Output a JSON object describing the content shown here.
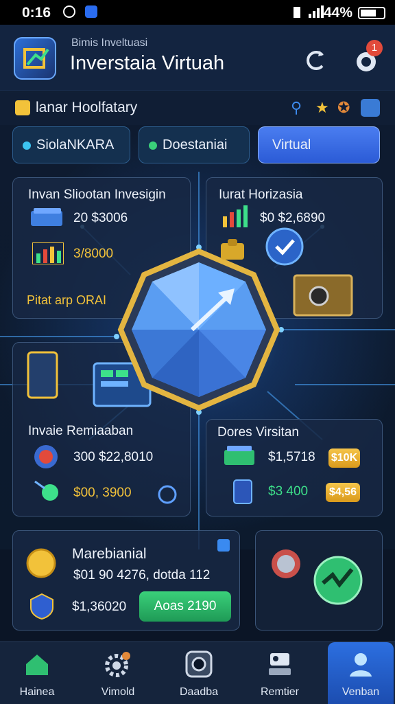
{
  "status_bar": {
    "time": "0:16",
    "battery": "44%"
  },
  "header": {
    "subtitle": "Bimis Inveltuasi",
    "title": "Inverstaia Virtuah",
    "notification_count": "1"
  },
  "section": {
    "title": "lanar Hoolfatary"
  },
  "tabs": [
    {
      "label": "SiolaNKARA",
      "dot_color": "#3cc3f0"
    },
    {
      "label": "Doestaniai",
      "dot_color": "#3ad07a"
    },
    {
      "label": "Virtual",
      "active": true
    }
  ],
  "cards": {
    "top_left": {
      "title": "Invan Sliootan Invesigin",
      "row1_value": "20 $3006",
      "row2_value": "3/8000",
      "footer": "Pitat arp ORAI"
    },
    "top_right": {
      "title": "Iurat Horizasia",
      "row1_value": "$0 $2,6890"
    },
    "mid_left": {
      "title": "Invaie Remiaaban",
      "row1_value": "300 $22,8010",
      "row2_value": "$00, 3900"
    },
    "mid_right": {
      "title": "Dores Virsitan",
      "row1_value": "$1,5718",
      "row1_badge": "$10K",
      "row2_value": "$3 400",
      "row2_badge": "$4,56"
    }
  },
  "bottom_card": {
    "title": "Marebianial",
    "line1": "$01 90 4276, dotda 112",
    "amount": "$1,36020",
    "action_label": "Aoas 2190"
  },
  "nav": [
    {
      "label": "Hainea",
      "icon": "home-icon"
    },
    {
      "label": "Vimold",
      "icon": "gear-icon"
    },
    {
      "label": "Daadba",
      "icon": "camera-icon"
    },
    {
      "label": "Remtier",
      "icon": "profile-card-icon"
    },
    {
      "label": "Venban",
      "icon": "user-icon",
      "active": true
    }
  ],
  "colors": {
    "accent": "#3b6fe6",
    "gold": "#f2c23a",
    "green": "#2fbf71",
    "card_border": "#3a5478"
  }
}
